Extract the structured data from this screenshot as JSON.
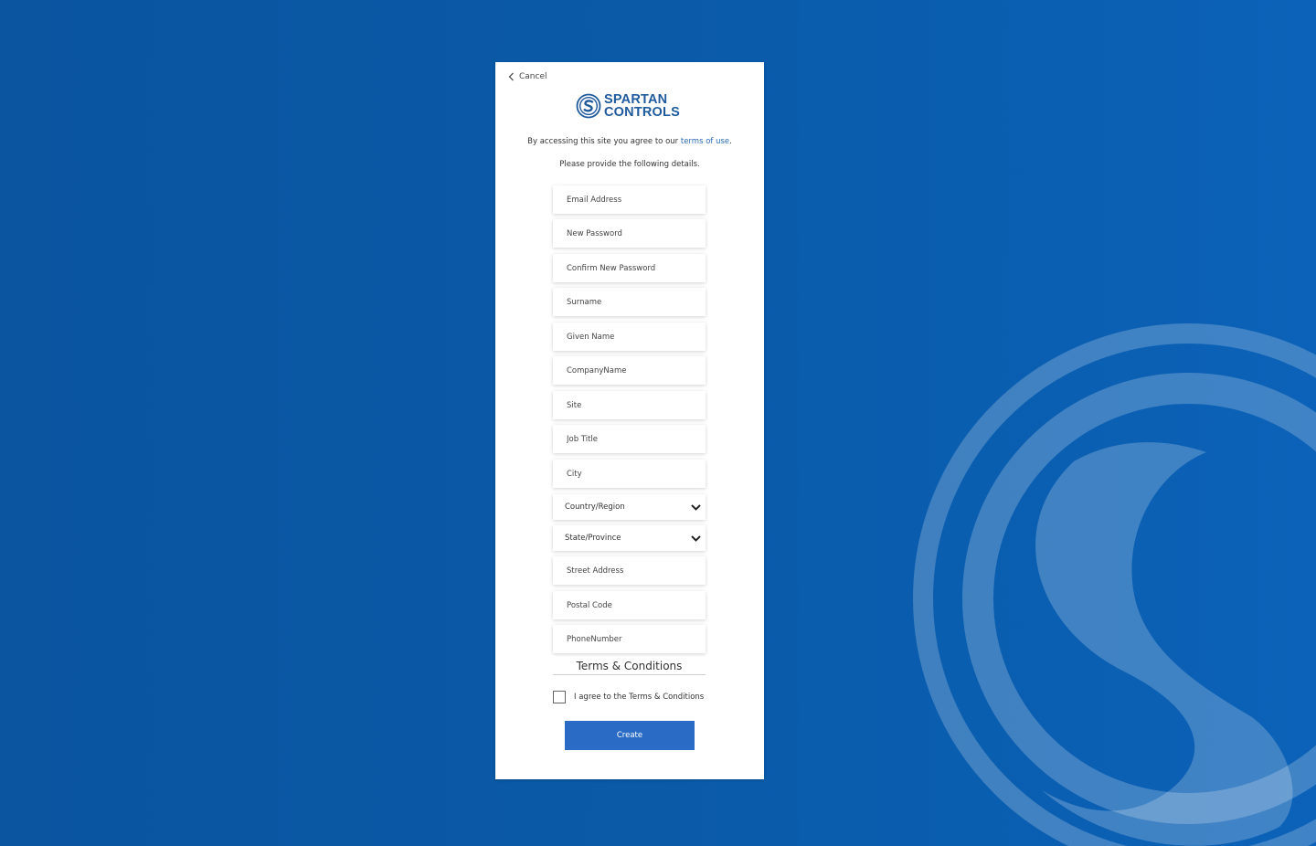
{
  "colors": {
    "background": "#0a5aa8",
    "brand": "#1f5a9c",
    "button": "#2a6cc5",
    "link": "#2a6bb6"
  },
  "header": {
    "cancel_label": "Cancel",
    "cancel_icon": "chevron-left-icon",
    "logo_line1": "SPARTAN",
    "logo_line2": "CONTROLS"
  },
  "intro": {
    "text_before": "By accessing this site you agree to our ",
    "link": "terms of use",
    "text_after": ".",
    "instructions": "Please provide the following details."
  },
  "fields": {
    "email": "Email Address",
    "new_password": "New Password",
    "confirm_password": "Confirm New Password",
    "surname": "Surname",
    "given_name": "Given Name",
    "company": "CompanyName",
    "site": "Site",
    "job_title": "Job Title",
    "city": "City",
    "country": "Country/Region",
    "state": "State/Province",
    "street": "Street Address",
    "postal": "Postal Code",
    "phone": "PhoneNumber"
  },
  "terms": {
    "title": "Terms & Conditions",
    "agree_label": "I agree to the Terms & Conditions"
  },
  "actions": {
    "create_label": "Create"
  }
}
